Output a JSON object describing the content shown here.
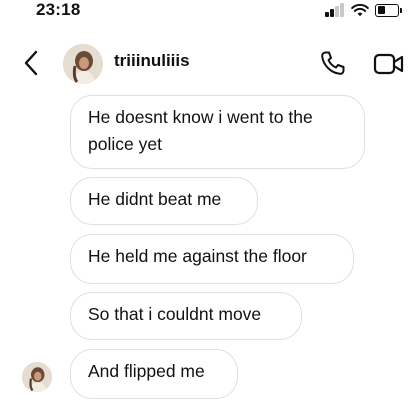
{
  "status_bar": {
    "time": "23:18"
  },
  "header": {
    "username": "triiinuliiis",
    "icons": {
      "back": "chevron-left-icon",
      "call": "phone-icon",
      "video": "video-camera-icon"
    }
  },
  "messages": [
    {
      "text": "He doesnt know i went to the\npolice yet"
    },
    {
      "text": "He didnt beat me"
    },
    {
      "text": "He held me against the floor"
    },
    {
      "text": "So that i couldnt move"
    },
    {
      "text": "And flipped me"
    }
  ],
  "colors": {
    "bubble_border": "#dfdfdf",
    "text": "#111111",
    "background": "#ffffff"
  }
}
